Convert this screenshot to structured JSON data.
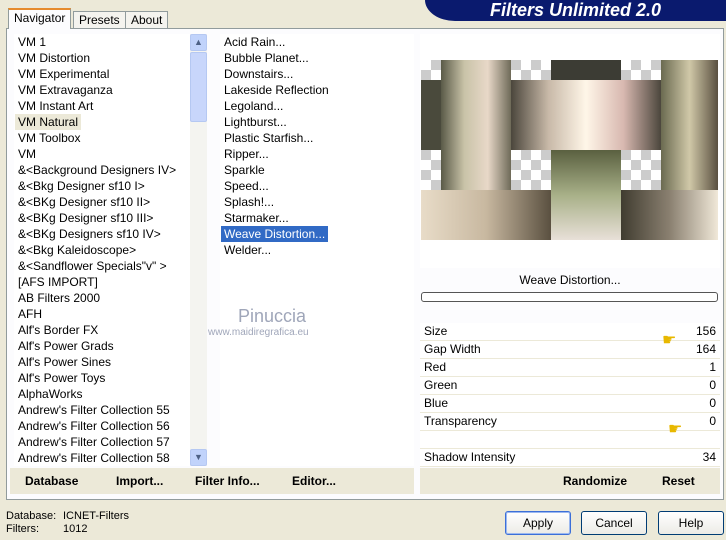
{
  "title": "Filters Unlimited 2.0",
  "tabs": [
    "Navigator",
    "Presets",
    "About"
  ],
  "categories": [
    "VM 1",
    "VM Distortion",
    "VM Experimental",
    "VM Extravaganza",
    "VM Instant Art",
    "VM Natural",
    "VM Toolbox",
    "VM",
    "&<Background Designers IV>",
    "&<Bkg Designer sf10 I>",
    "&<BKg Designer sf10 II>",
    "&<BKg Designer sf10 III>",
    "&<BKg Designers sf10 IV>",
    "&<Bkg Kaleidoscope>",
    "&<Sandflower Specials\"v\" >",
    "[AFS IMPORT]",
    "AB Filters 2000",
    "AFH",
    "Alf's Border FX",
    "Alf's Power Grads",
    "Alf's Power Sines",
    "Alf's Power Toys",
    "AlphaWorks",
    "Andrew's Filter Collection 55",
    "Andrew's Filter Collection 56",
    "Andrew's Filter Collection 57",
    "Andrew's Filter Collection 58"
  ],
  "filters": [
    "Acid Rain...",
    "Bubble Planet...",
    "Downstairs...",
    "Lakeside Reflection",
    "Legoland...",
    "Lightburst...",
    "Plastic Starfish...",
    "Ripper...",
    "Sparkle",
    "Speed...",
    "Splash!...",
    "Starmaker...",
    "Weave Distortion...",
    "Welder..."
  ],
  "selected_filter": "Weave Distortion...",
  "watermark": {
    "name": "Pinuccia",
    "url": "www.maidiregrafica.eu"
  },
  "params": [
    {
      "label": "Size",
      "value": "156"
    },
    {
      "label": "Gap Width",
      "value": "164"
    },
    {
      "label": "Red",
      "value": "1"
    },
    {
      "label": "Green",
      "value": "0"
    },
    {
      "label": "Blue",
      "value": "0"
    },
    {
      "label": "Transparency",
      "value": "0"
    },
    {
      "label": "Shadow Intensity",
      "value": "34"
    }
  ],
  "left_buttons": [
    "Database",
    "Import...",
    "Filter Info...",
    "Editor..."
  ],
  "right_buttons": [
    "Randomize",
    "Reset"
  ],
  "status": {
    "db_label": "Database:",
    "db_value": "ICNET-Filters",
    "filters_label": "Filters:",
    "filters_value": "1012"
  },
  "dialog_buttons": [
    "Apply",
    "Cancel",
    "Help"
  ]
}
